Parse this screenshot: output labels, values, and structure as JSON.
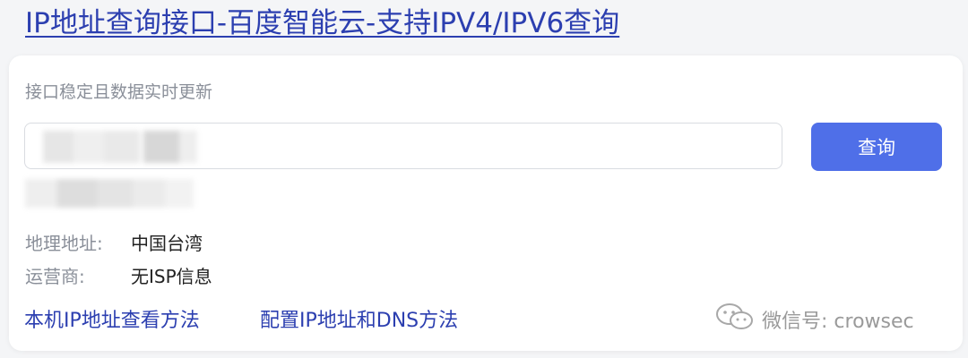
{
  "header": {
    "title_link": "IP地址查询接口-百度智能云-支持IPV4/IPV6查询"
  },
  "card": {
    "subtitle": "接口稳定且数据实时更新",
    "search": {
      "value": "",
      "placeholder": ""
    },
    "query_button": "查询",
    "results": [
      {
        "label": "地理地址:",
        "value": "中国台湾"
      },
      {
        "label": "运营商:",
        "value": "无ISP信息"
      }
    ],
    "links": [
      "本机IP地址查看方法",
      "配置IP地址和DNS方法"
    ],
    "watermark": "微信号: crowsec"
  },
  "colors": {
    "link": "#2c3fb0",
    "button": "#4f6fe8",
    "muted_text": "#8a8f99"
  }
}
